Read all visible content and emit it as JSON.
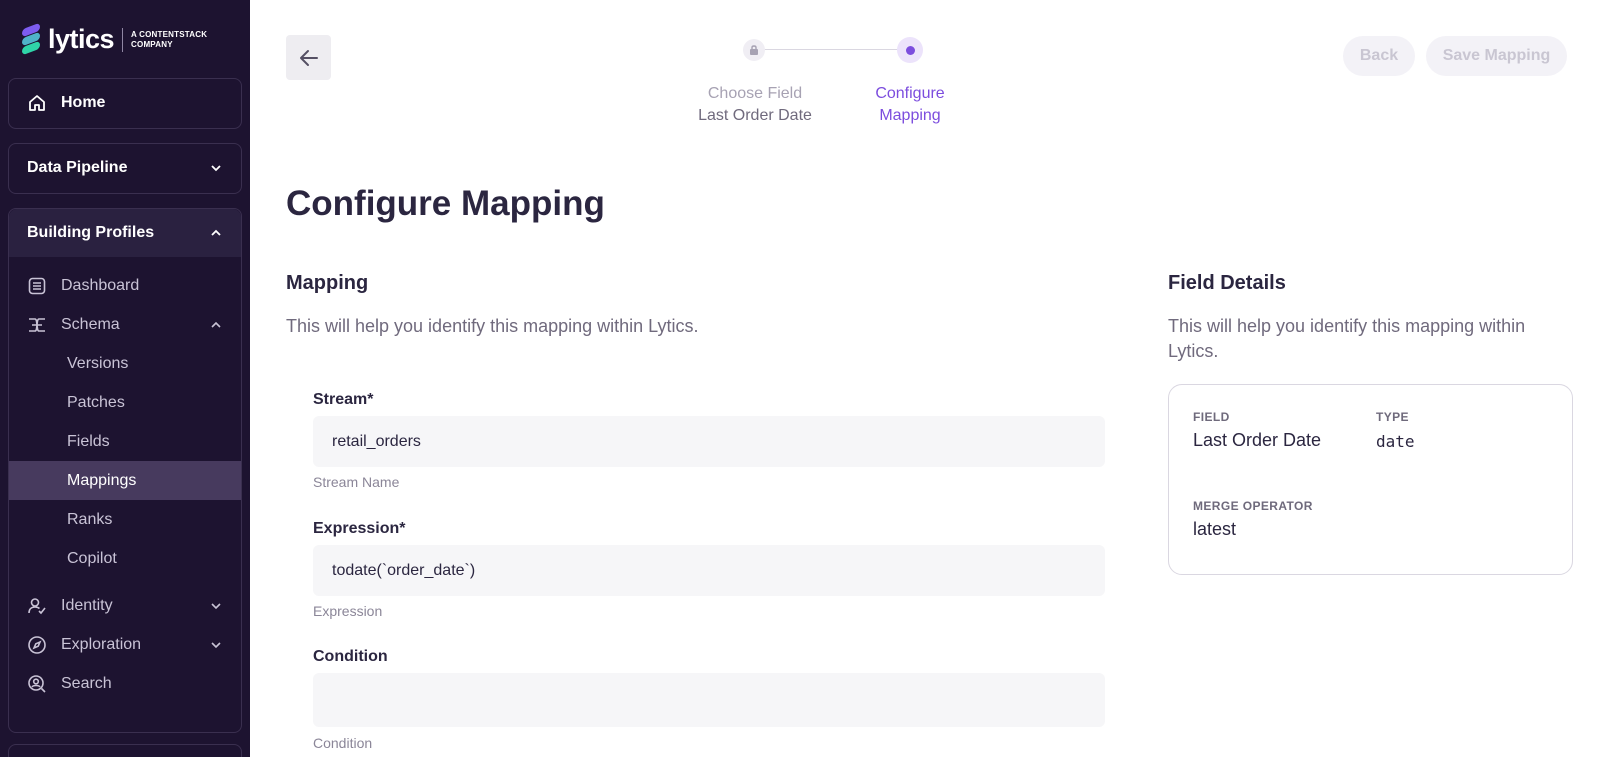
{
  "brand": {
    "name": "lytics",
    "tagline_line1": "A CONTENTSTACK",
    "tagline_line2": "COMPANY",
    "colors": [
      "#7d5cf0",
      "#4fb3c9",
      "#2fd4a8"
    ]
  },
  "sidebar": {
    "home": {
      "label": "Home",
      "icon": "home-icon"
    },
    "data_pipeline": {
      "label": "Data Pipeline",
      "icon": "chevron-down-icon"
    },
    "building_profiles": {
      "label": "Building Profiles",
      "icon": "chevron-up-icon",
      "items": [
        {
          "label": "Dashboard",
          "icon": "dashboard-icon"
        },
        {
          "label": "Schema",
          "icon": "schema-icon",
          "expanded": true
        },
        {
          "label": "Identity",
          "icon": "identity-icon"
        },
        {
          "label": "Exploration",
          "icon": "compass-icon"
        },
        {
          "label": "Search",
          "icon": "search-icon"
        }
      ],
      "schema_children": [
        {
          "label": "Versions"
        },
        {
          "label": "Patches"
        },
        {
          "label": "Fields"
        },
        {
          "label": "Mappings",
          "active": true
        },
        {
          "label": "Ranks"
        },
        {
          "label": "Copilot"
        }
      ]
    }
  },
  "stepper": {
    "step1_title": "Choose Field",
    "step1_value": "Last Order Date",
    "step2_line1": "Configure",
    "step2_line2": "Mapping"
  },
  "actions": {
    "back_label": "Back",
    "save_label": "Save Mapping"
  },
  "page": {
    "title": "Configure Mapping"
  },
  "mapping": {
    "title": "Mapping",
    "description": "This will help you identify this mapping within Lytics.",
    "stream": {
      "label": "Stream",
      "required_mark": "*",
      "value": "retail_orders",
      "help": "Stream Name"
    },
    "expression": {
      "label": "Expression",
      "required_mark": "*",
      "value": "todate(`order_date`)",
      "help": "Expression"
    },
    "condition": {
      "label": "Condition",
      "value": "",
      "help": "Condition"
    }
  },
  "field_details": {
    "title": "Field Details",
    "description_line1": "This will help you identify this mapping within",
    "description_line2": "Lytics.",
    "field_caption": "FIELD",
    "field_value": "Last Order Date",
    "type_caption": "TYPE",
    "type_value": "date",
    "merge_caption": "MERGE OPERATOR",
    "merge_value": "latest"
  },
  "colors": {
    "sidebar_bg": "#1d1330",
    "sidebar_active": "#473a5e",
    "accent": "#7c4dde"
  }
}
